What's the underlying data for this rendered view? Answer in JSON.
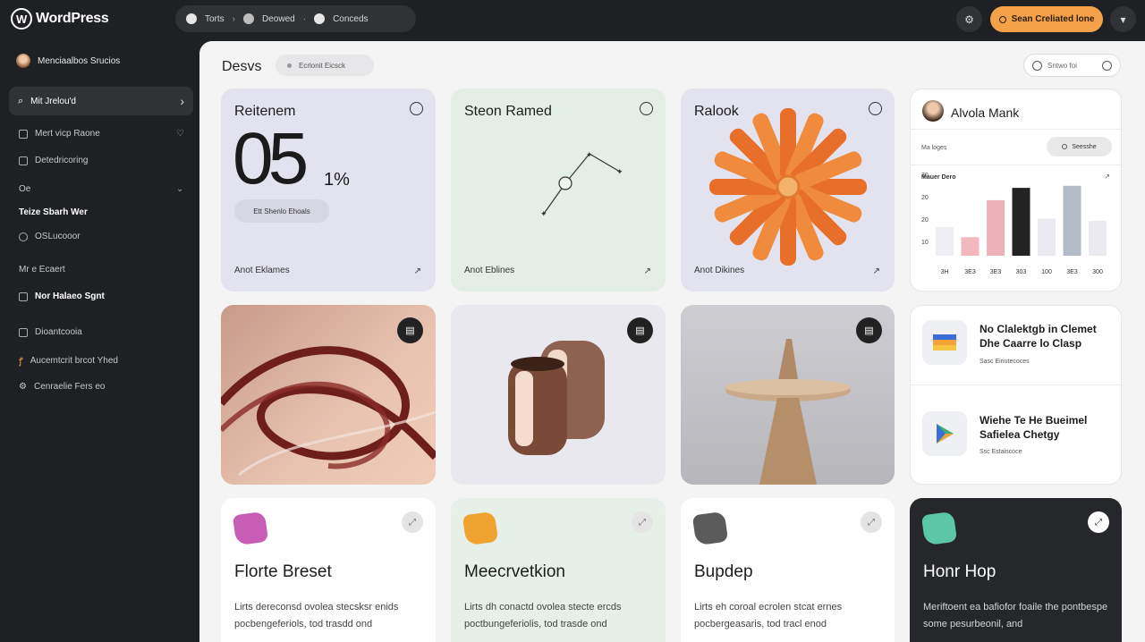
{
  "topbar": {
    "logo": "WordPress",
    "crumbs": [
      "Torts",
      "Deowed",
      "Conceds"
    ],
    "cta": "Sean Creliated lone",
    "icons": [
      "settings-icon",
      "globe-icon"
    ]
  },
  "sidebar": {
    "user": "Menciaalbos Srucios",
    "active": "Mit Jrelou'd",
    "items": [
      {
        "label": "Mert vicp Raone",
        "icon": "edit-icon"
      },
      {
        "label": "Detedricoring",
        "icon": "doc-icon"
      },
      {
        "label": "Oe",
        "icon": ""
      },
      {
        "label": "Teize Sbarh Wer",
        "icon": ""
      },
      {
        "label": "OSLucooor",
        "icon": "circle-icon"
      },
      {
        "label": "Mr e Ecaert",
        "icon": ""
      },
      {
        "label": "Nor Halaeo Sgnt",
        "icon": "square-icon"
      },
      {
        "label": "Dioantcooia",
        "icon": "grid-icon"
      },
      {
        "label": "Aucemtcrit brcot Yhed",
        "icon": "link-icon"
      },
      {
        "label": "Cenraelie Fers eo",
        "icon": "gear-icon"
      }
    ]
  },
  "main": {
    "title": "Desvs",
    "chip": "Ecrlonit Eicsck",
    "search": "Sntwo foi"
  },
  "stats": {
    "title": "Reitenem",
    "big": "05",
    "pct": "1%",
    "pill": "Ett Shenlo Ehoals",
    "footer": "Anot Eklames"
  },
  "line_card": {
    "title": "Steon Ramed",
    "footer": "Anot Eblines"
  },
  "flower_card": {
    "title": "Ralook",
    "footer": "Anot Dikines"
  },
  "profile": {
    "name": "Alvola Mank",
    "lbl": "Ma loges",
    "btn": "Seesshe",
    "chart_title": "Mauer Dero"
  },
  "chart_data": {
    "type": "bar",
    "categories": [
      "3H",
      "3E3",
      "3E3",
      "303",
      "100",
      "3E3",
      "300"
    ],
    "values": [
      14,
      9,
      27,
      33,
      18,
      34,
      17
    ],
    "ylim": [
      0,
      40
    ],
    "yticks": [
      "30",
      "20",
      "20",
      "10"
    ],
    "colors": [
      "#eeeef4",
      "#f3b7be",
      "#efb1b9",
      "#232323",
      "#eaeaf0",
      "#b3bcc6",
      "#eaeaf0"
    ],
    "xlabel": "",
    "ylabel": ""
  },
  "news": [
    {
      "title": "No Clalektgb in Clemet Dhe Caarre lo Clasp",
      "sub": "Sasc Eiriutecoces"
    },
    {
      "title": "Wiehe Te He Bueimel Safielea Chetgy",
      "sub": "Ssc Estaiscoce"
    }
  ],
  "bottom": [
    {
      "title": "Florte Breset",
      "text": "Lirts dereconsd ovolea stecsksr enids pocbengeferiols, tod trasdd ond",
      "color": "#c85db5"
    },
    {
      "title": "Meecrvetkion",
      "text": "Lirts dh conactd ovolea stecte ercds poctbungeferiolis, tod trasde ond",
      "color": "#f0a430"
    },
    {
      "title": "Bupdep",
      "text": "Lirts eh coroal ecrolen stcat ernes pocbergeasaris, tod tracl enod",
      "color": "#5b5b5b"
    },
    {
      "title": "Honr Hop",
      "text": "Meriftoent ea bafiofor foaile the pontbespe some pesurbeonil, and",
      "color": "#5cc7a6"
    }
  ]
}
